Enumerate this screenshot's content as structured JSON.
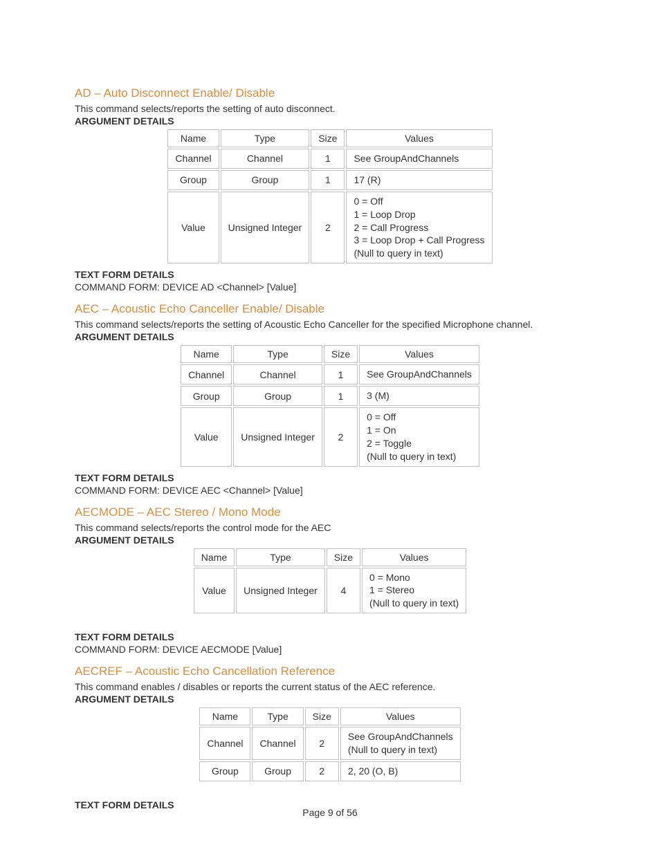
{
  "footer": "Page 9 of 56",
  "labels": {
    "argDetails": "ARGUMENT DETAILS",
    "textFormDetails": "TEXT FORM DETAILS",
    "thName": "Name",
    "thType": "Type",
    "thSize": "Size",
    "thValues": "Values"
  },
  "sections": [
    {
      "heading": "AD – Auto Disconnect Enable/ Disable",
      "desc": "This command selects/reports the setting of auto disconnect.",
      "rows": [
        {
          "name": "Channel",
          "type": "Channel",
          "size": "1",
          "values": "See GroupAndChannels"
        },
        {
          "name": "Group",
          "type": "Group",
          "size": "1",
          "values": "17 (R)"
        },
        {
          "name": "Value",
          "type": "Unsigned Integer",
          "size": "2",
          "values": "0 = Off\n1 = Loop Drop\n2 = Call Progress\n3 = Loop Drop + Call Progress\n(Null to query in text)"
        }
      ],
      "cmd": "COMMAND FORM: DEVICE AD <Channel> [Value]"
    },
    {
      "heading": "AEC – Acoustic Echo Canceller Enable/ Disable",
      "desc": "This command selects/reports the setting of Acoustic Echo Canceller for the specified Microphone channel.",
      "rows": [
        {
          "name": "Channel",
          "type": "Channel",
          "size": "1",
          "values": "See GroupAndChannels"
        },
        {
          "name": "Group",
          "type": "Group",
          "size": "1",
          "values": "3 (M)"
        },
        {
          "name": "Value",
          "type": "Unsigned Integer",
          "size": "2",
          "values": "0 = Off\n1 = On\n2 = Toggle\n(Null to query in text)"
        }
      ],
      "cmd": "COMMAND FORM: DEVICE AEC <Channel> [Value]"
    },
    {
      "heading": "AECMODE – AEC Stereo / Mono Mode",
      "desc": "This command selects/reports the control mode for the AEC",
      "rows": [
        {
          "name": "Value",
          "type": "Unsigned Integer",
          "size": "4",
          "values": "0 = Mono\n1 = Stereo\n(Null to query in text)"
        }
      ],
      "cmd": "COMMAND FORM: DEVICE AECMODE [Value]",
      "extraGap": true
    },
    {
      "heading": "AECREF – Acoustic Echo Cancellation Reference",
      "desc": "This command enables / disables or reports the current status of the AEC reference.",
      "rows": [
        {
          "name": "Channel",
          "type": "Channel",
          "size": "2",
          "values": "See GroupAndChannels\n(Null to query in text)"
        },
        {
          "name": "Group",
          "type": "Group",
          "size": "2",
          "values": "2, 20 (O, B)"
        }
      ],
      "cmd": "",
      "extraGap": true
    }
  ]
}
